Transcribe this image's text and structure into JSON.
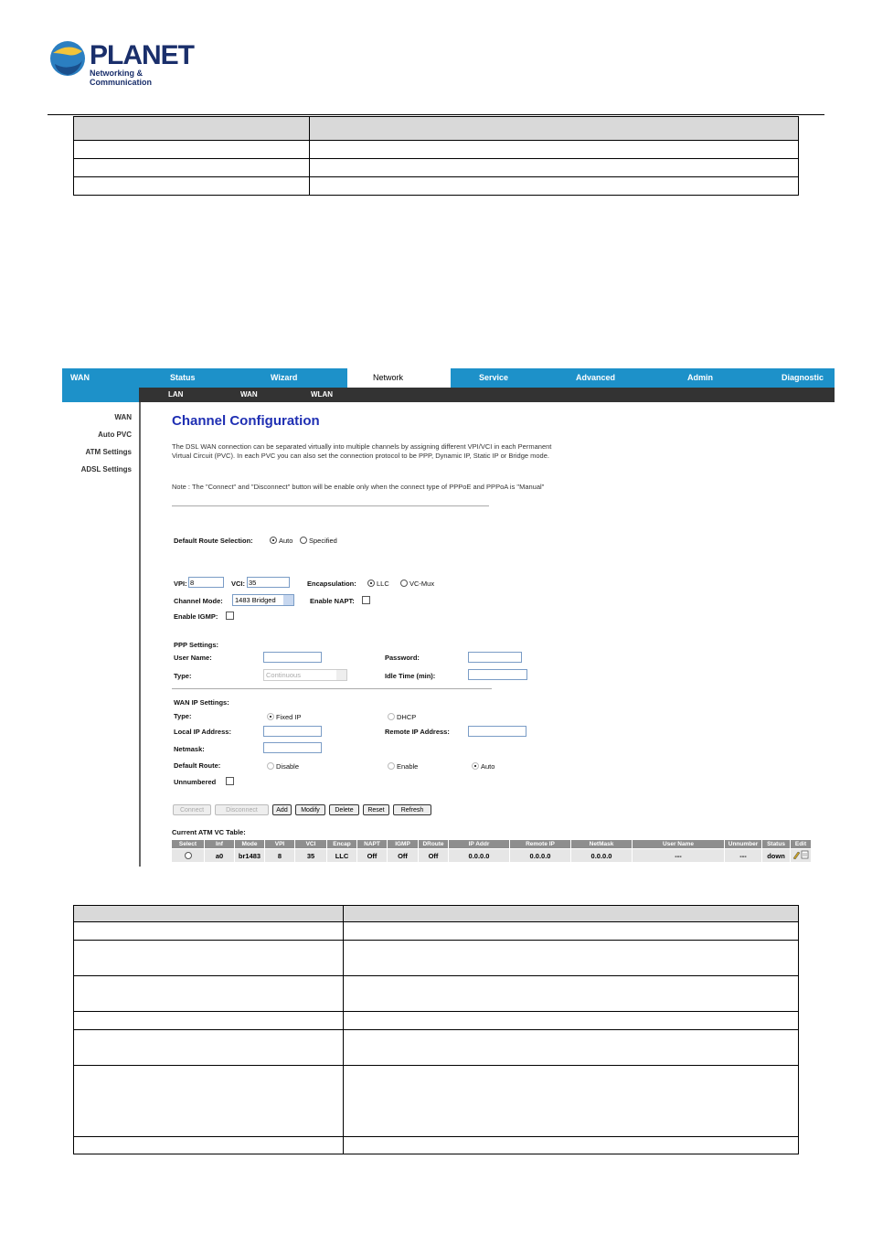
{
  "logo": {
    "name": "PLANET",
    "tagline": "Networking & Communication"
  },
  "router_ui": {
    "top_tabs": [
      "WAN",
      "Status",
      "Wizard",
      "Network",
      "Service",
      "Advanced",
      "Admin",
      "Diagnostic"
    ],
    "active_tab": "Network",
    "sub_tabs": [
      "LAN",
      "WAN",
      "WLAN"
    ],
    "sidebar": [
      "WAN",
      "Auto PVC",
      "ATM Settings",
      "ADSL Settings"
    ],
    "title": "Channel Configuration",
    "description": "The DSL WAN connection can be separated virtually into multiple channels by assigning different VPI/VCI in each Permanent Virtual Circuit (PVC). In each PVC you can also set the connection protocol to be PPP, Dynamic IP, Static IP or Bridge mode.",
    "note": "Note : The \"Connect\" and \"Disconnect\" button will be enable only when the connect type of PPPoE and PPPoA is \"Manual\"",
    "default_route": {
      "label": "Default Route Selection:",
      "auto": "Auto",
      "specified": "Specified"
    },
    "vpi_label": "VPI:",
    "vpi_value": "8",
    "vci_label": "VCI:",
    "vci_value": "35",
    "encap": {
      "label": "Encapsulation:",
      "llc": "LLC",
      "vcmux": "VC-Mux"
    },
    "channel_mode": {
      "label": "Channel Mode:",
      "value": "1483 Bridged"
    },
    "napt_label": "Enable NAPT:",
    "igmp_label": "Enable IGMP:",
    "ppp": {
      "heading": "PPP Settings:",
      "user_label": "User Name:",
      "password_label": "Password:",
      "type_label": "Type:",
      "type_value": "Continuous",
      "idle_label": "Idle Time (min):"
    },
    "wan_ip": {
      "heading": "WAN IP Settings:",
      "type_label": "Type:",
      "fixed": "Fixed IP",
      "dhcp": "DHCP",
      "local_label": "Local IP Address:",
      "remote_label": "Remote IP Address:",
      "netmask_label": "Netmask:",
      "route_label": "Default Route:",
      "disable": "Disable",
      "enable": "Enable",
      "auto": "Auto",
      "unnumbered_label": "Unnumbered"
    },
    "buttons": [
      "Connect",
      "Disconnect",
      "Add",
      "Modify",
      "Delete",
      "Reset",
      "Refresh"
    ],
    "table_title": "Current ATM VC Table:",
    "table_headers": [
      "Select",
      "Inf",
      "Mode",
      "VPI",
      "VCI",
      "Encap",
      "NAPT",
      "IGMP",
      "DRoute",
      "IP Addr",
      "Remote IP",
      "NetMask",
      "User Name",
      "Unnumber",
      "Status",
      "Edit"
    ],
    "table_row": [
      "",
      "a0",
      "br1483",
      "8",
      "35",
      "LLC",
      "Off",
      "Off",
      "Off",
      "0.0.0.0",
      "0.0.0.0",
      "0.0.0.0",
      "---",
      "---",
      "down",
      ""
    ]
  }
}
